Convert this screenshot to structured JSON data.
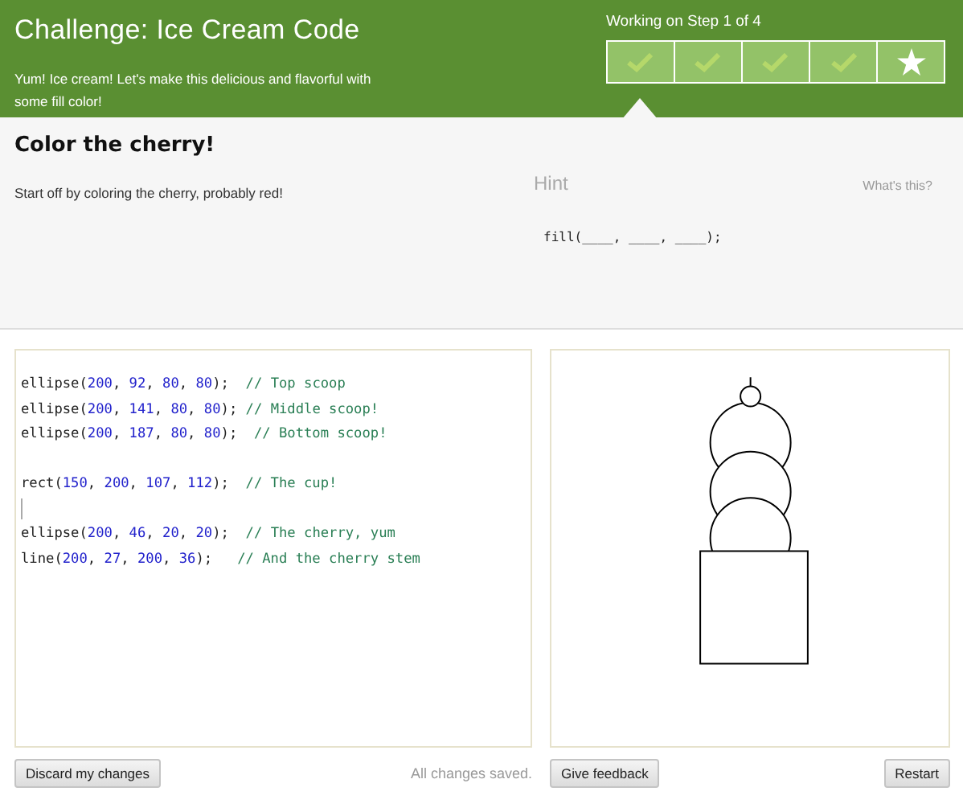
{
  "header": {
    "title": "Challenge: Ice Cream Code",
    "description": "Yum! Ice cream! Let's make this delicious and flavorful with some fill color!",
    "progress_label": "Working on Step 1 of 4",
    "steps": [
      {
        "kind": "check",
        "selected": true,
        "completed": false
      },
      {
        "kind": "check",
        "selected": false,
        "completed": false
      },
      {
        "kind": "check",
        "selected": false,
        "completed": false
      },
      {
        "kind": "check",
        "selected": false,
        "completed": false
      },
      {
        "kind": "star",
        "selected": false,
        "completed": false
      }
    ]
  },
  "instructions": {
    "title": "Color the cherry!",
    "text": "Start off by coloring the cherry, probably red!",
    "hint_title": "Hint",
    "hint_link": "What's this?",
    "hint_code": "fill(____, ____, ____);"
  },
  "editor": {
    "lines": [
      [
        {
          "kind": "plain",
          "text": "ellipse("
        },
        {
          "kind": "number",
          "text": "200"
        },
        {
          "kind": "plain",
          "text": ", "
        },
        {
          "kind": "number",
          "text": "92"
        },
        {
          "kind": "plain",
          "text": ", "
        },
        {
          "kind": "number",
          "text": "80"
        },
        {
          "kind": "plain",
          "text": ", "
        },
        {
          "kind": "number",
          "text": "80"
        },
        {
          "kind": "plain",
          "text": ");  "
        },
        {
          "kind": "comment",
          "text": "// Top scoop"
        }
      ],
      [
        {
          "kind": "plain",
          "text": "ellipse("
        },
        {
          "kind": "number",
          "text": "200"
        },
        {
          "kind": "plain",
          "text": ", "
        },
        {
          "kind": "number",
          "text": "141"
        },
        {
          "kind": "plain",
          "text": ", "
        },
        {
          "kind": "number",
          "text": "80"
        },
        {
          "kind": "plain",
          "text": ", "
        },
        {
          "kind": "number",
          "text": "80"
        },
        {
          "kind": "plain",
          "text": "); "
        },
        {
          "kind": "comment",
          "text": "// Middle scoop!"
        }
      ],
      [
        {
          "kind": "plain",
          "text": "ellipse("
        },
        {
          "kind": "number",
          "text": "200"
        },
        {
          "kind": "plain",
          "text": ", "
        },
        {
          "kind": "number",
          "text": "187"
        },
        {
          "kind": "plain",
          "text": ", "
        },
        {
          "kind": "number",
          "text": "80"
        },
        {
          "kind": "plain",
          "text": ", "
        },
        {
          "kind": "number",
          "text": "80"
        },
        {
          "kind": "plain",
          "text": ");  "
        },
        {
          "kind": "comment",
          "text": "// Bottom scoop!"
        }
      ],
      [
        {
          "kind": "blank"
        }
      ],
      [
        {
          "kind": "plain",
          "text": "rect("
        },
        {
          "kind": "number",
          "text": "150"
        },
        {
          "kind": "plain",
          "text": ", "
        },
        {
          "kind": "number",
          "text": "200"
        },
        {
          "kind": "plain",
          "text": ", "
        },
        {
          "kind": "number",
          "text": "107"
        },
        {
          "kind": "plain",
          "text": ", "
        },
        {
          "kind": "number",
          "text": "112"
        },
        {
          "kind": "plain",
          "text": ");  "
        },
        {
          "kind": "comment",
          "text": "// The cup!"
        }
      ],
      [
        {
          "kind": "cursor"
        }
      ],
      [
        {
          "kind": "plain",
          "text": "ellipse("
        },
        {
          "kind": "number",
          "text": "200"
        },
        {
          "kind": "plain",
          "text": ", "
        },
        {
          "kind": "number",
          "text": "46"
        },
        {
          "kind": "plain",
          "text": ", "
        },
        {
          "kind": "number",
          "text": "20"
        },
        {
          "kind": "plain",
          "text": ", "
        },
        {
          "kind": "number",
          "text": "20"
        },
        {
          "kind": "plain",
          "text": ");  "
        },
        {
          "kind": "comment",
          "text": "// The cherry, yum"
        }
      ],
      [
        {
          "kind": "plain",
          "text": "line("
        },
        {
          "kind": "number",
          "text": "200"
        },
        {
          "kind": "plain",
          "text": ", "
        },
        {
          "kind": "number",
          "text": "27"
        },
        {
          "kind": "plain",
          "text": ", "
        },
        {
          "kind": "number",
          "text": "200"
        },
        {
          "kind": "plain",
          "text": ", "
        },
        {
          "kind": "number",
          "text": "36"
        },
        {
          "kind": "plain",
          "text": ");   "
        },
        {
          "kind": "comment",
          "text": "// And the cherry stem"
        }
      ]
    ]
  },
  "footer": {
    "discard_button": "Discard my changes",
    "save_status": "All changes saved.",
    "feedback_button": "Give feedback",
    "restart_button": "Restart"
  }
}
